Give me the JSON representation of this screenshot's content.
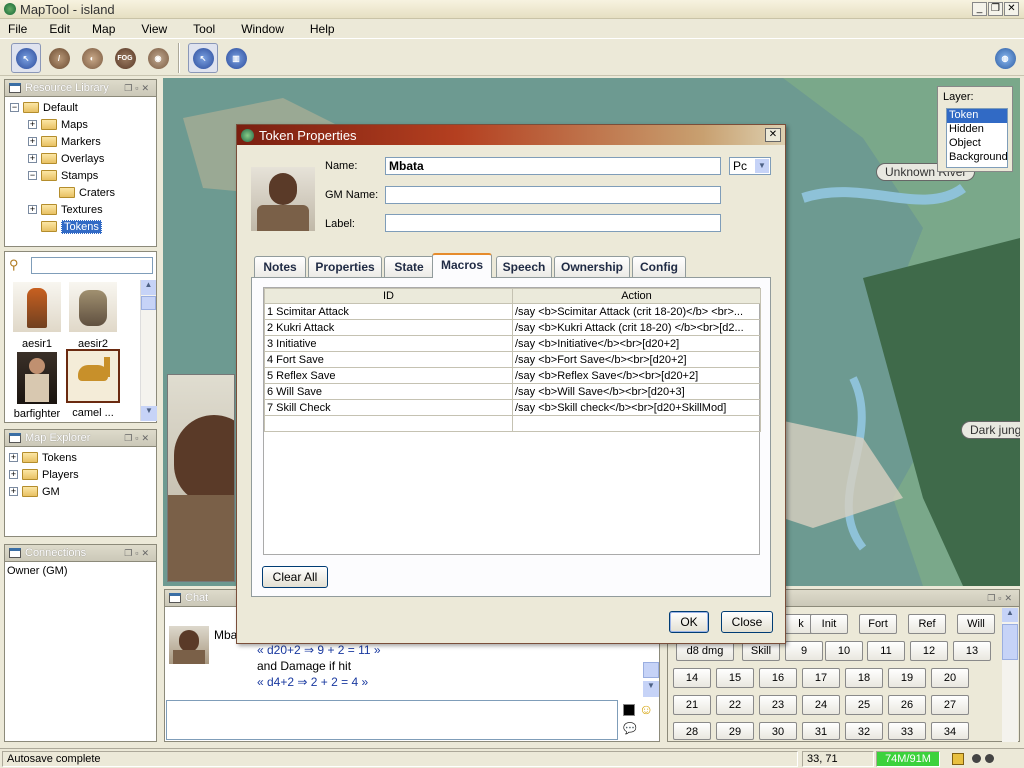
{
  "window": {
    "title": "MapTool - island"
  },
  "menu": [
    "File",
    "Edit",
    "Map",
    "View",
    "Tool",
    "Window",
    "Help"
  ],
  "toolbar": {
    "fog_label": "FOG"
  },
  "resource_library": {
    "title": "Resource Library",
    "tree": [
      {
        "label": "Default",
        "depth": 0,
        "expander": "−"
      },
      {
        "label": "Maps",
        "depth": 1,
        "expander": "+"
      },
      {
        "label": "Markers",
        "depth": 1,
        "expander": "+"
      },
      {
        "label": "Overlays",
        "depth": 1,
        "expander": "+"
      },
      {
        "label": "Stamps",
        "depth": 1,
        "expander": "−"
      },
      {
        "label": "Craters",
        "depth": 2,
        "expander": ""
      },
      {
        "label": "Textures",
        "depth": 1,
        "expander": "+"
      },
      {
        "label": "Tokens",
        "depth": 1,
        "expander": "",
        "selected": true
      }
    ],
    "search_value": "",
    "thumbs": [
      "aesir1",
      "aesir2",
      "barfighter",
      "camel ..."
    ]
  },
  "map_explorer": {
    "title": "Map Explorer",
    "items": [
      "Tokens",
      "Players",
      "GM"
    ]
  },
  "connections": {
    "title": "Connections",
    "items": [
      "Owner (GM)"
    ]
  },
  "layer_panel": {
    "title": "Layer:",
    "options": [
      "Token",
      "Hidden",
      "Object",
      "Background"
    ],
    "selected": "Token"
  },
  "map_labels": {
    "label1": "Unknown River",
    "label2": "Dark jungle"
  },
  "dialog": {
    "title": "Token Properties",
    "name_label": "Name:",
    "name_value": "Mbata",
    "type_value": "Pc",
    "gm_name_label": "GM Name:",
    "gm_name_value": "",
    "label_label": "Label:",
    "label_value": "",
    "tabs": [
      "Notes",
      "Properties",
      "State",
      "Macros",
      "Speech",
      "Ownership",
      "Config"
    ],
    "active_tab": "Macros",
    "table": {
      "headers": [
        "ID",
        "Action"
      ],
      "rows": [
        [
          "1 Scimitar Attack",
          "/say <b>Scimitar Attack (crit 18-20)</b> <br>..."
        ],
        [
          "2 Kukri Attack",
          "/say <b>Kukri Attack (crit 18-20) </b><br>[d2..."
        ],
        [
          "3 Initiative",
          "/say <b>Initiative</b><br>[d20+2]"
        ],
        [
          "4 Fort Save",
          "/say <b>Fort Save</b><br>[d20+2]"
        ],
        [
          "5 Reflex Save",
          "/say <b>Reflex Save</b><br>[d20+2]"
        ],
        [
          "6 Will Save",
          "/say <b>Will Save</b><br>[d20+3]"
        ],
        [
          "7 Skill Check",
          "/say <b>Skill check</b><br>[d20+SkillMod]"
        ],
        [
          "",
          ""
        ]
      ]
    },
    "clear_all": "Clear All",
    "ok": "OK",
    "close": "Close"
  },
  "chat": {
    "title": "Chat",
    "sender": "Mba",
    "lines": [
      "« d20+2 ⇒ 9 + 2 = 11 »",
      "and Damage if hit",
      "« d4+2 ⇒ 2 + 2 = 4 »"
    ],
    "input_value": ""
  },
  "macros": {
    "row1": [
      "k",
      "Init",
      "Fort",
      "Ref",
      "Will"
    ],
    "row2": [
      "d8 dmg",
      "Skill",
      "9",
      "10",
      "11",
      "12",
      "13"
    ],
    "row3": [
      "14",
      "15",
      "16",
      "17",
      "18",
      "19",
      "20"
    ],
    "row4": [
      "21",
      "22",
      "23",
      "24",
      "25",
      "26",
      "27"
    ],
    "row5": [
      "28",
      "29",
      "30",
      "31",
      "32",
      "33",
      "34"
    ]
  },
  "status": {
    "message": "Autosave complete",
    "coords": "33, 71",
    "memory": "74M/91M"
  },
  "colors": {
    "selection": "#316ac5",
    "map_water": "#6d9a91",
    "dialog_title": "#9a2e18"
  }
}
